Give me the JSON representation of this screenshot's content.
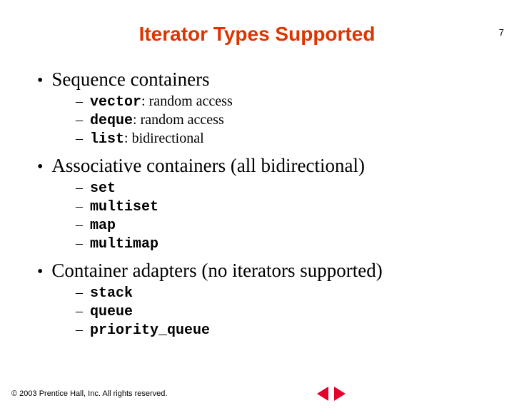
{
  "page_number": "7",
  "title": "Iterator Types Supported",
  "sections": [
    {
      "heading": "Sequence containers",
      "items": [
        {
          "code": "vector",
          "desc": ": random access"
        },
        {
          "code": "deque",
          "desc": ": random access"
        },
        {
          "code": "list",
          "desc": ": bidirectional"
        }
      ]
    },
    {
      "heading": "Associative containers (all bidirectional)",
      "items": [
        {
          "code": "set",
          "desc": ""
        },
        {
          "code": "multiset",
          "desc": ""
        },
        {
          "code": "map",
          "desc": ""
        },
        {
          "code": "multimap",
          "desc": ""
        }
      ]
    },
    {
      "heading": "Container adapters (no iterators supported)",
      "items": [
        {
          "code": "stack",
          "desc": ""
        },
        {
          "code": "queue",
          "desc": ""
        },
        {
          "code": "priority_queue",
          "desc": ""
        }
      ]
    }
  ],
  "footer": {
    "copyright": "© 2003 Prentice Hall, Inc. All rights reserved."
  }
}
